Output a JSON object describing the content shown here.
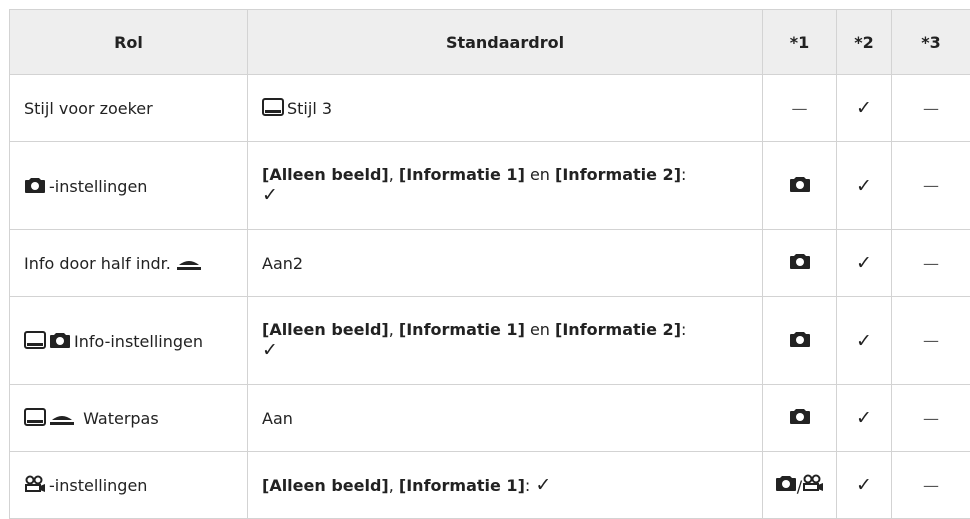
{
  "headers": [
    "Rol",
    "Standaardrol",
    "*1",
    "*2",
    "*3"
  ],
  "rows": [
    {
      "rol": "Stijl voor zoeker",
      "std": "Stijl 3",
      "c1": "—",
      "c2": "✓",
      "c3": "—"
    },
    {
      "rol": "-instellingen",
      "std_a": "[Alleen beeld]",
      "std_b": ", ",
      "std_c": "[Informatie 1]",
      "std_d": " en ",
      "std_e": "[Informatie 2]",
      "std_f": ":",
      "std_g": "✓",
      "c2": "✓",
      "c3": "—"
    },
    {
      "rol": "Info door half indr.",
      "std": "Aan2",
      "c2": "✓",
      "c3": "—"
    },
    {
      "rol": "Info-instellingen",
      "std_a": "[Alleen beeld]",
      "std_b": ", ",
      "std_c": "[Informatie 1]",
      "std_d": " en ",
      "std_e": "[Informatie 2]",
      "std_f": ":",
      "std_g": "✓",
      "c2": "✓",
      "c3": "—"
    },
    {
      "rol": "Waterpas",
      "std": "Aan",
      "c2": "✓",
      "c3": "—"
    },
    {
      "rol": "-instellingen",
      "std_a": "[Alleen beeld]",
      "std_b": ", ",
      "std_c": "[Informatie 1]",
      "std_d": ": ",
      "std_g": "✓",
      "c1_sep": "/",
      "c2": "✓",
      "c3": "—"
    }
  ]
}
